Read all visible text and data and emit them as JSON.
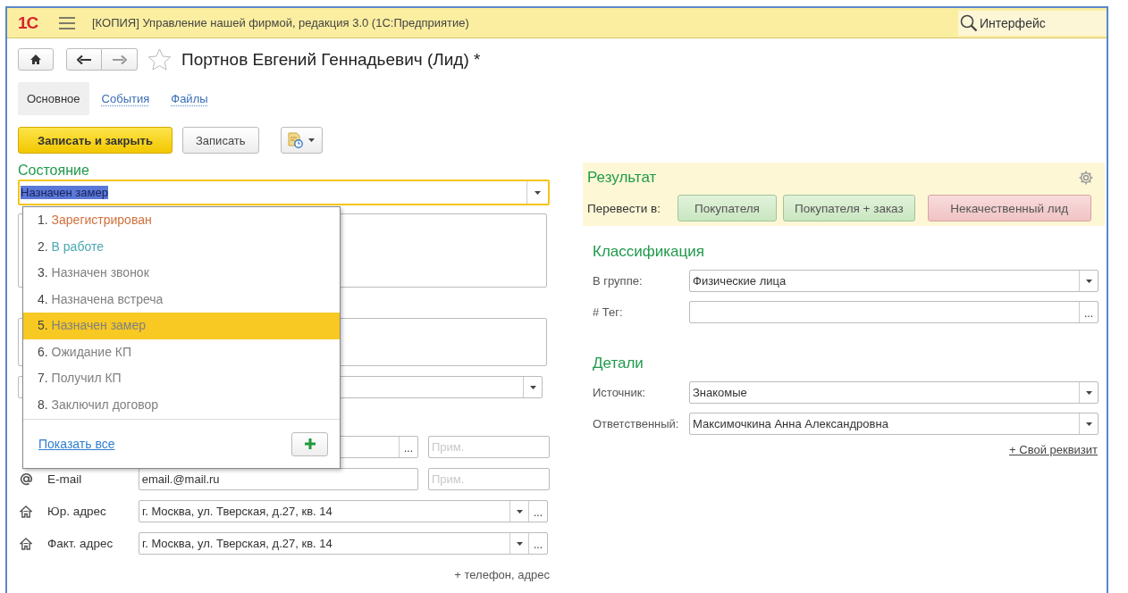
{
  "app": {
    "logo": "1С",
    "title": "[КОПИЯ] Управление нашей фирмой, редакция 3.0  (1С:Предприятие)",
    "search": {
      "value": "Интерфейс"
    }
  },
  "form": {
    "title": "Портнов Евгений Геннадьевич (Лид) *",
    "favorite": false,
    "tabs": [
      {
        "label": "Основное",
        "selected": true
      },
      {
        "label": "События",
        "selected": false
      },
      {
        "label": "Файлы",
        "selected": false
      }
    ],
    "buttons": [
      {
        "label": "Записать и закрыть",
        "kind": "primary"
      },
      {
        "label": "Записать",
        "kind": "default"
      },
      {
        "kind": "menu"
      }
    ]
  },
  "status": {
    "label": "Состояние",
    "value": "Назначен замер",
    "focused": true,
    "dropdown": {
      "items": [
        {
          "number": "1.",
          "label": "Зарегистрирован",
          "color": "#d2703c",
          "selected": false
        },
        {
          "number": "2.",
          "label": "В работе",
          "color": "#4aa8b0",
          "selected": false
        },
        {
          "number": "3.",
          "label": "Назначен звонок",
          "color": "#808080",
          "selected": false
        },
        {
          "number": "4.",
          "label": "Назначена встреча",
          "color": "#808080",
          "selected": false
        },
        {
          "number": "5.",
          "label": "Назначен замер",
          "color": "#808080",
          "selected": true
        },
        {
          "number": "6.",
          "label": "Ожидание КП",
          "color": "#808080",
          "selected": false
        },
        {
          "number": "7.",
          "label": "Получил КП",
          "color": "#808080",
          "selected": false
        },
        {
          "number": "8.",
          "label": "Заключил договор",
          "color": "#808080",
          "selected": false
        }
      ],
      "show_all": "Показать все"
    }
  },
  "contacts": [
    {
      "kind": "phone",
      "pick_label": "...",
      "note_placeholder": "Прим."
    },
    {
      "kind": "email",
      "label": "E-mail",
      "value": "email.@mail.ru",
      "note_placeholder": "Прим."
    },
    {
      "kind": "address",
      "label": "Юр. адрес",
      "value": "г. Москва, ул. Тверская, д.27, кв. 14",
      "pick_label": "..."
    },
    {
      "kind": "address",
      "label": "Факт. адрес",
      "value": "г. Москва, ул. Тверская, д.27, кв. 14",
      "pick_label": "..."
    }
  ],
  "add_contact": "+ телефон, адрес",
  "result": {
    "title": "Результат",
    "label": "Перевести в:",
    "actions": [
      {
        "label": "Покупателя",
        "kind": "accept"
      },
      {
        "label": "Покупателя + заказ",
        "kind": "accept"
      },
      {
        "label": "Некачественный лид",
        "kind": "reject"
      }
    ]
  },
  "sections": [
    {
      "title": "Классификация",
      "fields": [
        {
          "label": "В группе:",
          "value": "Физические лица",
          "kind": "select"
        },
        {
          "label": "# Тег:",
          "kind": "pick",
          "pick_label": "..."
        }
      ]
    },
    {
      "title": "Детали",
      "fields": [
        {
          "label": "Источник:",
          "value": "Знакомые",
          "kind": "select"
        },
        {
          "label": "Ответственный:",
          "value": "Максимочкина Анна Александровна",
          "kind": "select"
        }
      ]
    }
  ],
  "custom_field_link": "+ Свой реквизит"
}
